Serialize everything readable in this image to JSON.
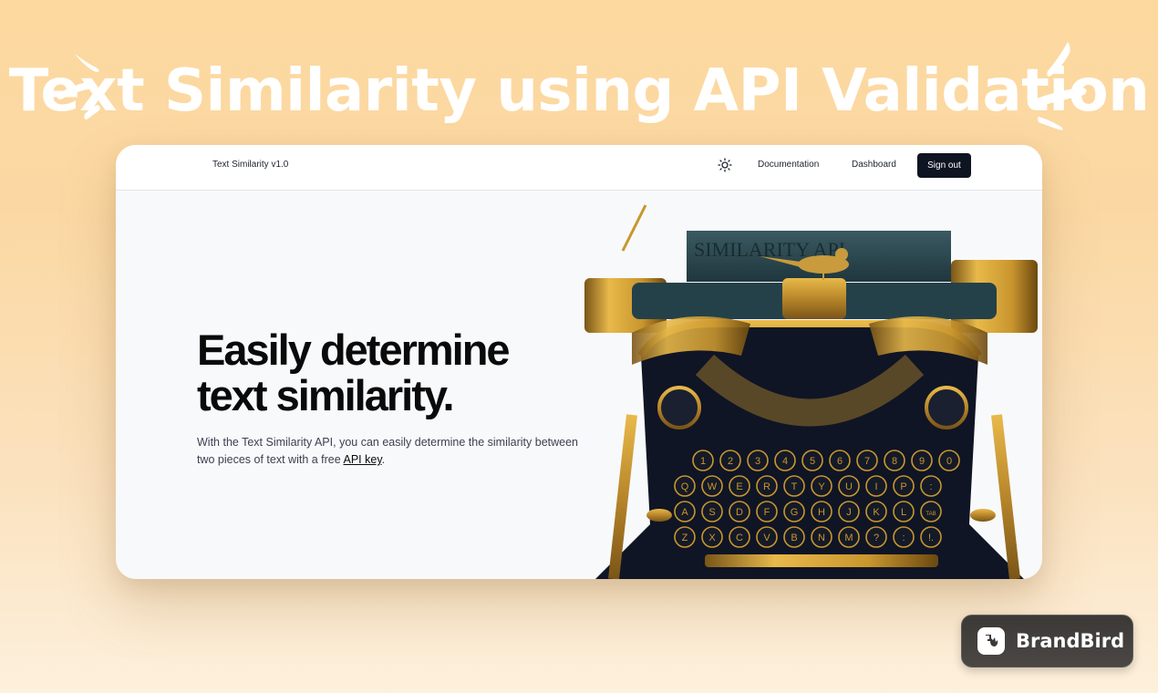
{
  "banner": {
    "headline": "Text Similarity using API Validation"
  },
  "app": {
    "brand": "Text Similarity v1.0",
    "nav": {
      "theme_toggle_icon": "sun-icon",
      "links": [
        {
          "label": "Documentation"
        },
        {
          "label": "Dashboard"
        }
      ],
      "signout_label": "Sign out"
    },
    "hero": {
      "title_line1": "Easily determine",
      "title_line2": "text similarity.",
      "description_prefix": "With the Text Similarity API, you can easily determine the similarity between two pieces of text with a free ",
      "description_link": "API key",
      "description_suffix": ".",
      "image": {
        "subject": "ornate gold-and-black vintage typewriter with a golden bird",
        "paper_text": "SIMILARITY API",
        "key_rows": [
          [
            "1",
            "2",
            "3",
            "4",
            "5",
            "6",
            "7",
            "8",
            "9",
            "0"
          ],
          [
            "Q",
            "W",
            "E",
            "R",
            "T",
            "Y",
            "U",
            "I",
            "P",
            ":"
          ],
          [
            "A",
            "S",
            "D",
            "F",
            "G",
            "H",
            "J",
            "K",
            "L",
            "TAB"
          ],
          [
            "Z",
            "X",
            "C",
            "V",
            "B",
            "N",
            "M",
            "?",
            ":",
            "!."
          ]
        ]
      }
    }
  },
  "watermark": {
    "label": "BrandBird",
    "icon": "brandbird-logo-icon"
  },
  "colors": {
    "background_top": "#fdd9a0",
    "background_bottom": "#fdf0dc",
    "card_bg": "#f8f9fb",
    "nav_bg": "#ffffff",
    "signout_bg": "#0f1422",
    "title_text": "#0a0a0a",
    "body_text": "#3b4150",
    "gold": "#c9962e",
    "typewriter_dark": "#0f1525",
    "paper_teal": "#2f4a52"
  }
}
